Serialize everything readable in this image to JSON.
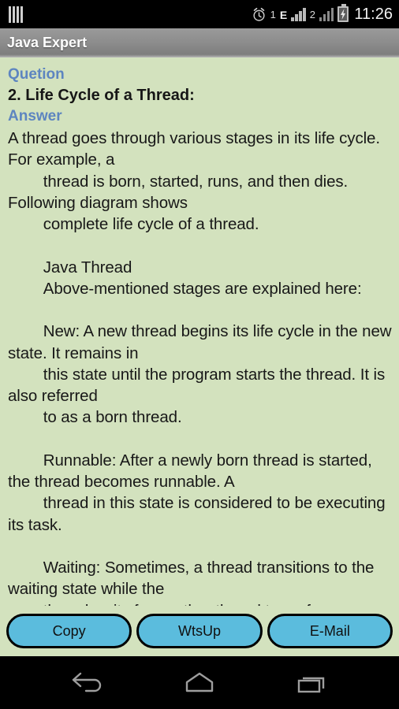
{
  "status_bar": {
    "sim_icon": "sim-bars-icon",
    "alarm_icon": "alarm-clock-icon",
    "alarm_badge": "1",
    "network_type": "E",
    "signal_icon_1": "signal-bars-icon",
    "sim_badge": "2",
    "signal_icon_2": "signal-bars-icon",
    "battery_icon": "battery-charging-icon",
    "time": "11:26"
  },
  "action_bar": {
    "title": "Java Expert"
  },
  "content": {
    "question_label": "Quetion",
    "question_title": "2. Life Cycle of a Thread:",
    "answer_label": "Answer",
    "answer_body": "A thread goes through various stages in its life cycle. For example, a\n        thread is born, started, runs, and then dies. Following diagram shows\n        complete life cycle of a thread.\n\n        Java Thread\n        Above-mentioned stages are explained here:\n\n        New: A new thread begins its life cycle in the new state. It remains in\n        this state until the program starts the thread. It is also referred\n        to as a born thread.\n\n        Runnable: After a newly born thread is started, the thread becomes runnable. A\n        thread in this state is considered to be executing its task.\n\n        Waiting: Sometimes, a thread transitions to the waiting state while the\n        thread waits for another thread to perform a"
  },
  "buttons": {
    "copy_label": "Copy",
    "whatsapp_label": "WtsUp",
    "email_label": "E-Mail"
  },
  "nav_bar": {
    "back_icon": "back-arrow-icon",
    "home_icon": "home-icon",
    "recents_icon": "recent-apps-icon"
  },
  "colors": {
    "content_background": "#d3e2be",
    "accent_blue": "#5d85c0",
    "button_fill": "#5bbcdd",
    "action_bar": "#8e8e8e"
  }
}
